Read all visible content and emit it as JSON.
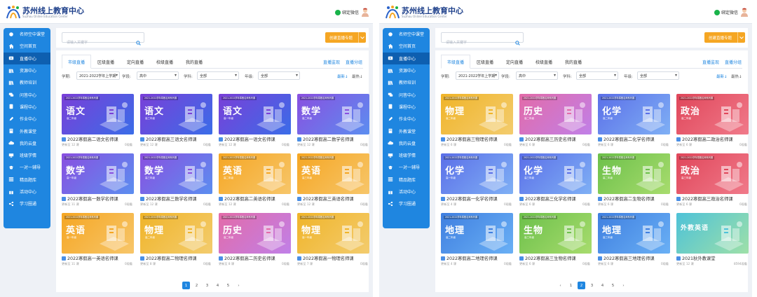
{
  "panels": [
    {
      "header": {
        "brand_cn": "苏州线上教育中心",
        "brand_en": "Suzhou Online Education Center",
        "bind_label": "绑定微信"
      },
      "sidebar": {
        "items": [
          {
            "label": "名师空中课堂",
            "icon": "circle-icon"
          },
          {
            "label": "空间首页",
            "icon": "home-icon"
          },
          {
            "label": "直播中心",
            "icon": "live-icon",
            "active": true
          },
          {
            "label": "资源中心",
            "icon": "books-icon"
          },
          {
            "label": "教师培训",
            "icon": "books-icon"
          },
          {
            "label": "问答中心",
            "icon": "qa-icon"
          },
          {
            "label": "课程中心",
            "icon": "book-icon"
          },
          {
            "label": "作业中心",
            "icon": "pen-icon"
          },
          {
            "label": "外教课堂",
            "icon": "doc-icon"
          },
          {
            "label": "我的云盘",
            "icon": "cloud-icon"
          },
          {
            "label": "班级学情",
            "icon": "monitor-icon"
          },
          {
            "label": "一对一辅导",
            "icon": "cap-icon"
          },
          {
            "label": "精品题库",
            "icon": "list-icon"
          },
          {
            "label": "活动中心",
            "icon": "gift-icon"
          },
          {
            "label": "学习圈通",
            "icon": "share-icon"
          }
        ]
      },
      "search": {
        "placeholder": "请输入关键字"
      },
      "create_button": "创建直播专题",
      "tabs": [
        "市级直播",
        "区级直播",
        "定向直播",
        "校级直播",
        "我的直播"
      ],
      "right_links": [
        "直播监现",
        "直播分组"
      ],
      "filters": {
        "term_label": "学期:",
        "term": "2021-2022学年上学期",
        "stage_label": "学段:",
        "stage": "高中",
        "subject_label": "学科:",
        "subject": "全部",
        "grade_label": "年级:",
        "grade": "全部"
      },
      "sort": {
        "newest": "最新↓",
        "hottest": "最热↓"
      },
      "cards": [
        {
          "ribbon": "2021-2022学年寒假名师系列课",
          "subject": "语文",
          "grade": "高二年级",
          "title": "2022寒假高二语文名师课",
          "updated": "更新至 12 课",
          "views": "0观看",
          "c1": "#7a3fd8",
          "c2": "#3a6de8"
        },
        {
          "ribbon": "2021-2022学年寒假名师系列课",
          "subject": "语文",
          "grade": "高三年级",
          "title": "2022寒假高三语文名师课",
          "updated": "更新至 12 课",
          "views": "0观看",
          "c1": "#7a3fd8",
          "c2": "#3a6de8"
        },
        {
          "ribbon": "2021-2022学年寒假名师系列课",
          "subject": "语文",
          "grade": "高一年级",
          "title": "2022寒假高一语文名师课",
          "updated": "更新至 12 课",
          "views": "0观看",
          "c1": "#7a3fd8",
          "c2": "#3a6de8"
        },
        {
          "ribbon": "2021-2022学年寒假名师系列课",
          "subject": "数学",
          "grade": "高二年级",
          "title": "2022寒假高二数学名师课",
          "updated": "更新至 12 课",
          "views": "0观看",
          "c1": "#8a4fe0",
          "c2": "#5b8ef0"
        },
        {
          "ribbon": "2021-2022学年寒假名师系列课",
          "subject": "数学",
          "grade": "高一年级",
          "title": "2022寒假高一数学名师课",
          "updated": "更新至 11 课",
          "views": "0观看",
          "c1": "#8a4fe0",
          "c2": "#5b8ef0"
        },
        {
          "ribbon": "2021-2022学年寒假名师系列课",
          "subject": "数学",
          "grade": "高三年级",
          "title": "2022寒假高三数学名师课",
          "updated": "更新至 12 课",
          "views": "0观看",
          "c1": "#8a4fe0",
          "c2": "#5b8ef0"
        },
        {
          "ribbon": "2021-2022学年寒假名师系列课",
          "subject": "英语",
          "grade": "高二年级",
          "title": "2022寒假高二英语名师课",
          "updated": "更新至 12 课",
          "views": "0观看",
          "c1": "#f5a623",
          "c2": "#f7c66a"
        },
        {
          "ribbon": "2021-2022学年寒假名师系列课",
          "subject": "英语",
          "grade": "高三年级",
          "title": "2022寒假高三英语名师课",
          "updated": "更新至 12 课",
          "views": "0观看",
          "c1": "#f5a623",
          "c2": "#f7c66a"
        },
        {
          "ribbon": "2021-2022学年寒假名师系列课",
          "subject": "英语",
          "grade": "高一年级",
          "title": "2022寒假高一英语名师课",
          "updated": "更新至 11 课",
          "views": "0观看",
          "c1": "#f5a623",
          "c2": "#f7c66a"
        },
        {
          "ribbon": "2021-2022学年寒假名师系列课",
          "subject": "物理",
          "grade": "高二年级",
          "title": "2022寒假高二物理名师课",
          "updated": "更新至 8 课",
          "views": "0观看",
          "c1": "#f0b429",
          "c2": "#f3cc6e"
        },
        {
          "ribbon": "2021-2022学年寒假名师系列课",
          "subject": "历史",
          "grade": "高二年级",
          "title": "2022寒假高二历史名师课",
          "updated": "更新至 8 课",
          "views": "0观看",
          "c1": "#e36ba8",
          "c2": "#c080e8"
        },
        {
          "ribbon": "2021-2022学年寒假名师系列课",
          "subject": "物理",
          "grade": "高一年级",
          "title": "2022寒假高一物理名师课",
          "updated": "更新至 7 课",
          "views": "0观看",
          "c1": "#f0b429",
          "c2": "#f3cc6e"
        }
      ],
      "pagination": [
        "1",
        "2",
        "3",
        "4",
        "5",
        "›"
      ],
      "active_page": 0
    },
    {
      "header": {
        "brand_cn": "苏州线上教育中心",
        "brand_en": "Suzhou Online Education Center",
        "bind_label": "绑定微信"
      },
      "sidebar": {
        "items": [
          {
            "label": "名师空中课堂",
            "icon": "circle-icon"
          },
          {
            "label": "空间首页",
            "icon": "home-icon"
          },
          {
            "label": "直播中心",
            "icon": "live-icon",
            "active": true
          },
          {
            "label": "资源中心",
            "icon": "books-icon"
          },
          {
            "label": "教师培训",
            "icon": "books-icon"
          },
          {
            "label": "问答中心",
            "icon": "qa-icon"
          },
          {
            "label": "课程中心",
            "icon": "book-icon"
          },
          {
            "label": "作业中心",
            "icon": "pen-icon"
          },
          {
            "label": "外教课堂",
            "icon": "doc-icon"
          },
          {
            "label": "我的云盘",
            "icon": "cloud-icon"
          },
          {
            "label": "班级学情",
            "icon": "monitor-icon"
          },
          {
            "label": "一对一辅导",
            "icon": "cap-icon"
          },
          {
            "label": "精品题库",
            "icon": "list-icon"
          },
          {
            "label": "活动中心",
            "icon": "gift-icon"
          },
          {
            "label": "学习圈通",
            "icon": "share-icon"
          }
        ]
      },
      "search": {
        "placeholder": "请输入关键字"
      },
      "create_button": "创建直播专题",
      "tabs": [
        "市级直播",
        "区级直播",
        "定向直播",
        "校级直播",
        "我的直播"
      ],
      "right_links": [
        "直播监现",
        "直播分组"
      ],
      "filters": {
        "term_label": "学期:",
        "term": "2021-2022学年上学期",
        "stage_label": "学段:",
        "stage": "高中",
        "subject_label": "学科:",
        "subject": "全部",
        "grade_label": "年级:",
        "grade": "全部"
      },
      "sort": {
        "newest": "最新↓",
        "hottest": "最热↓"
      },
      "cards": [
        {
          "ribbon": "2021-2022学年寒假名师系列课",
          "subject": "物理",
          "grade": "高二年级",
          "title": "2022寒假高三物理名师课",
          "updated": "更新至 6 课",
          "views": "0观看",
          "c1": "#f0b429",
          "c2": "#f3cc6e"
        },
        {
          "ribbon": "2021-2022学年寒假名师系列课",
          "subject": "历史",
          "grade": "高二年级",
          "title": "2022寒假高三历史名师课",
          "updated": "更新至 6 课",
          "views": "0观看",
          "c1": "#e36ba8",
          "c2": "#c080e8"
        },
        {
          "ribbon": "2021-2022学年寒假名师系列课",
          "subject": "化学",
          "grade": "高二年级",
          "title": "2022寒假高二化学名师课",
          "updated": "更新至 6 课",
          "views": "0观看",
          "c1": "#5b6fe8",
          "c2": "#7fb0f5"
        },
        {
          "ribbon": "2021-2022学年寒假名师系列课",
          "subject": "政治",
          "grade": "高二年级",
          "title": "2022寒假高二政治名师课",
          "updated": "更新至 6 课",
          "views": "0观看",
          "c1": "#e0465a",
          "c2": "#f07a8a"
        },
        {
          "ribbon": "2021-2022学年寒假名师系列课",
          "subject": "化学",
          "grade": "高一年级",
          "title": "2022寒假高一化学名师课",
          "updated": "更新至 4 课",
          "views": "0观看",
          "c1": "#5b6fe8",
          "c2": "#7fb0f5"
        },
        {
          "ribbon": "2021-2022学年寒假名师系列课",
          "subject": "化学",
          "grade": "高三年级",
          "title": "2022寒假高三化学名师课",
          "updated": "更新至 6 课",
          "views": "0观看",
          "c1": "#5b6fe8",
          "c2": "#7fb0f5"
        },
        {
          "ribbon": "2021-2022学年寒假名师系列课",
          "subject": "生物",
          "grade": "高二年级",
          "title": "2022寒假高二生物名师课",
          "updated": "更新至 6 课",
          "views": "0观看",
          "c1": "#6cc04a",
          "c2": "#a8dc6e"
        },
        {
          "ribbon": "2021-2022学年寒假名师系列课",
          "subject": "政治",
          "grade": "高三年级",
          "title": "2022寒假高三政治名师课",
          "updated": "更新至 6 课",
          "views": "0观看",
          "c1": "#e0465a",
          "c2": "#f07a8a"
        },
        {
          "ribbon": "2021-2022学年寒假名师系列课",
          "subject": "地理",
          "grade": "高二年级",
          "title": "2022寒假高二地理名师课",
          "updated": "更新至 4 课",
          "views": "0观看",
          "c1": "#3f7fe0",
          "c2": "#6ab0f5"
        },
        {
          "ribbon": "2021-2022学年寒假名师系列课",
          "subject": "生物",
          "grade": "高三年级",
          "title": "2022寒假高三生物名师课",
          "updated": "更新至 6 课",
          "views": "0观看",
          "c1": "#6cc04a",
          "c2": "#a8dc6e"
        },
        {
          "ribbon": "2021-2022学年寒假名师系列课",
          "subject": "地理",
          "grade": "高三年级",
          "title": "2022寒假高三地理名师课",
          "updated": "更新至 6 课",
          "views": "0观看",
          "c1": "#3f7fe0",
          "c2": "#6ab0f5"
        },
        {
          "ribbon": "",
          "subject": "外教英语",
          "grade": "",
          "title": "2021秋外教课堂",
          "updated": "更新至 12 课",
          "views": "8594观看",
          "c1": "#4ec2d8",
          "c2": "#9ee0a8"
        }
      ],
      "pagination": [
        "‹",
        "1",
        "2",
        "3",
        "4",
        "5",
        "›"
      ],
      "active_page": 2
    }
  ]
}
